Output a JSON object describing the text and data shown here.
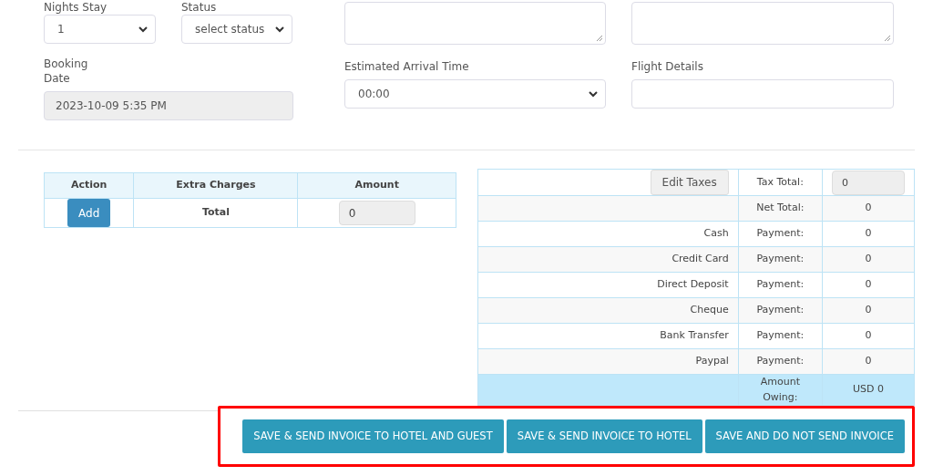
{
  "form": {
    "nights_stay": {
      "label": "Nights Stay",
      "value": "1"
    },
    "status": {
      "label": "Status",
      "value": "select status"
    },
    "booking_date": {
      "label": "Booking Date",
      "value": "2023-10-09 5:35 PM",
      "disabled": true
    },
    "arrival_time": {
      "label": "Estimated Arrival Time",
      "value": "00:00"
    },
    "flight_details": {
      "label": "Flight Details"
    }
  },
  "extra_charges": {
    "columns": [
      "Action",
      "Extra Charges",
      "Amount"
    ],
    "add_button": "Add",
    "total_label": "Total",
    "total_value": "0"
  },
  "summary": [
    {
      "kind": "taxes",
      "button": "Edit Taxes",
      "label": "Tax Total:",
      "value": "0"
    },
    {
      "kind": "total",
      "label": "Net Total:",
      "value": "0"
    },
    {
      "kind": "payment",
      "method": "Cash",
      "label": "Payment:",
      "value": "0"
    },
    {
      "kind": "payment",
      "method": "Credit Card",
      "label": "Payment:",
      "value": "0"
    },
    {
      "kind": "payment",
      "method": "Direct Deposit",
      "label": "Payment:",
      "value": "0"
    },
    {
      "kind": "payment",
      "method": "Cheque",
      "label": "Payment:",
      "value": "0"
    },
    {
      "kind": "payment",
      "method": "Bank Transfer",
      "label": "Payment:",
      "value": "0"
    },
    {
      "kind": "payment",
      "method": "Paypal",
      "label": "Payment:",
      "value": "0"
    },
    {
      "kind": "owing",
      "label": "Amount Owing:",
      "value": "USD 0"
    }
  ],
  "actions": {
    "highlighted": true,
    "buttons": [
      "SAVE & SEND INVOICE TO HOTEL AND GUEST",
      "SAVE & SEND INVOICE TO HOTEL",
      "SAVE AND DO NOT SEND INVOICE"
    ]
  }
}
